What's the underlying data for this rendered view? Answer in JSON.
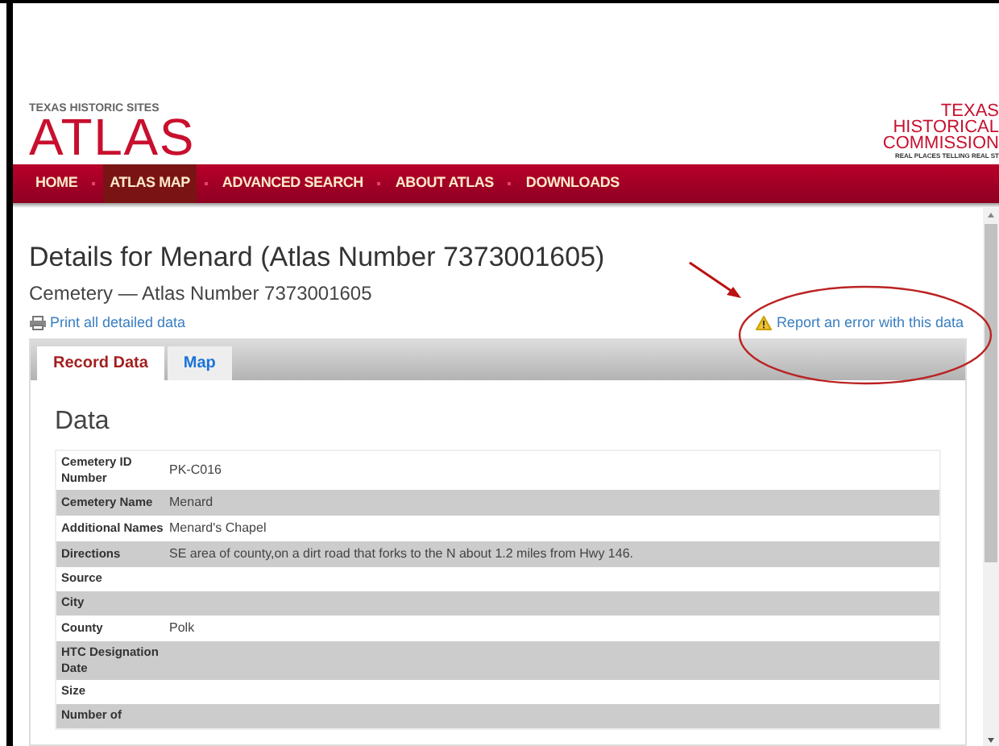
{
  "logo": {
    "eyebrow": "TEXAS HISTORIC SITES",
    "title": "ATLAS"
  },
  "partner_logo": {
    "lines": [
      "TEXAS",
      "HISTORICAL",
      "COMMISSION"
    ],
    "tagline": "REAL PLACES TELLING REAL ST"
  },
  "nav": [
    {
      "label": "HOME",
      "selected": false
    },
    {
      "label": "ATLAS MAP",
      "selected": true
    },
    {
      "label": "ADVANCED SEARCH",
      "selected": false
    },
    {
      "label": "ABOUT ATLAS",
      "selected": false
    },
    {
      "label": "DOWNLOADS",
      "selected": false
    }
  ],
  "page": {
    "title": "Details for Menard (Atlas Number 7373001605)",
    "subtitle": "Cemetery — Atlas Number 7373001605",
    "print_link": "Print all detailed data",
    "report_link": "Report an error with this data"
  },
  "tabs": [
    {
      "label": "Record Data",
      "selected": true
    },
    {
      "label": "Map",
      "selected": false
    }
  ],
  "section_title": "Data",
  "rows": [
    {
      "label": "Cemetery ID Number",
      "value": "PK-C016"
    },
    {
      "label": "Cemetery Name",
      "value": "Menard"
    },
    {
      "label": "Additional Names",
      "value": "Menard's Chapel"
    },
    {
      "label": "Directions",
      "value": "SE area of county,on a dirt road that forks to the N about 1.2 miles from Hwy 146."
    },
    {
      "label": "Source"
    },
    {
      "label": "City"
    },
    {
      "label": "County",
      "value": "Polk"
    },
    {
      "label": "HTC Designation Date"
    },
    {
      "label": "Size"
    },
    {
      "label": "Number of"
    }
  ]
}
